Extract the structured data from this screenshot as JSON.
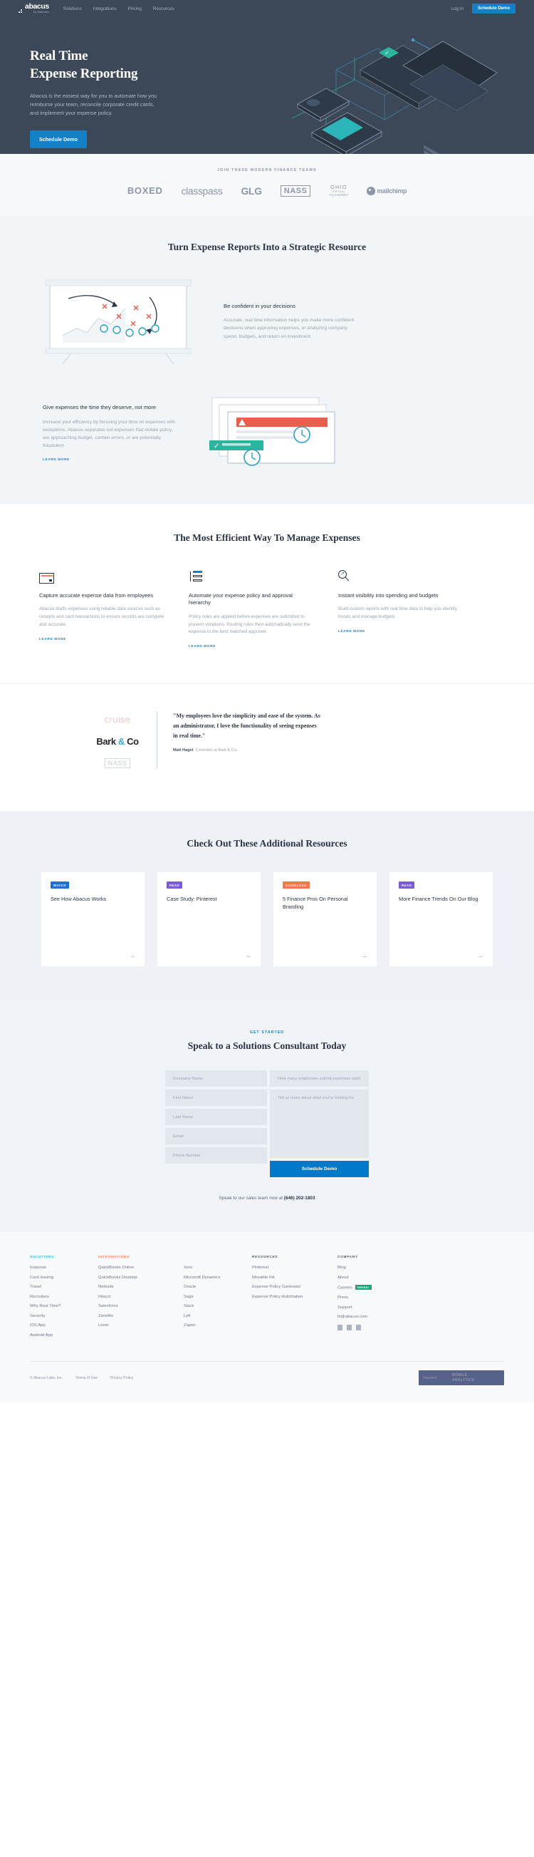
{
  "header": {
    "logo_text": "abacus",
    "logo_sub": "by emburse",
    "nav": [
      {
        "label": "Solutions"
      },
      {
        "label": "Integrations"
      },
      {
        "label": "Pricing"
      },
      {
        "label": "Resources"
      }
    ],
    "login_label": "Log In",
    "demo_label": "Schedule Demo"
  },
  "hero": {
    "title_line1": "Real Time",
    "title_line2": "Expense Reporting",
    "paragraph": "Abacus is the easiest way for you to automate how you reimburse your team, reconcile corporate credit cards, and implement your expense policy.",
    "cta_label": "Schedule Demo"
  },
  "logostrip": {
    "title": "JOIN THESE MODERN FINANCE TEAMS",
    "logos": [
      {
        "name": "BOXED"
      },
      {
        "name": "classpass"
      },
      {
        "name": "GLG"
      },
      {
        "name": "NASS"
      },
      {
        "name": "OHIO",
        "line2": "VIRTUAL",
        "line3": "ACADEMY"
      },
      {
        "name": "mailchimp"
      }
    ]
  },
  "strategic": {
    "title": "Turn Expense Reports Into a Strategic Resource",
    "features": [
      {
        "heading": "Be confident in your decisions",
        "body": "Accurate, real time information helps you make more confident decisions when approving expenses, or analyzing company spend, budgets, and return on investment."
      },
      {
        "heading": "Give expenses the time they deserve, not more",
        "body": "Increase your efficiency by focusing your time on expenses with exceptions. Abacus separates out expenses that violate policy, are approaching budget, contain errors, or are potentially fraudulent.",
        "link": "LEARN MORE"
      }
    ]
  },
  "efficient": {
    "title": "The Most Efficient Way To Manage Expenses",
    "columns": [
      {
        "icon": "credit-card-icon",
        "heading": "Capture accurate expense data from employees",
        "body": "Abacus drafts expenses using reliable data sources such as receipts and card transactions to ensure records are complete and accurate.",
        "link": "LEARN MORE"
      },
      {
        "icon": "workflow-list-icon",
        "heading": "Automate your expense policy and approval hierarchy",
        "body": "Policy rules are applied before expenses are submitted to prevent violations. Routing rules then automatically send the expense to the best matched approver.",
        "link": "LEARN MORE"
      },
      {
        "icon": "magnifier-trend-icon",
        "heading": "Instant visibility into spending and budgets",
        "body": "Build custom reports with real time data to help you identify trends and manage budgets.",
        "link": "LEARN MORE"
      }
    ]
  },
  "testimonial": {
    "logos": [
      {
        "name": "cruise"
      },
      {
        "name": "Bark & Co"
      },
      {
        "name": "NASS"
      }
    ],
    "quote": "\"My employees love the simplicity and ease of the system. As an administrator, I love the functionality of seeing expenses in real time.\"",
    "author": "Matt Hagel",
    "author_role": ", Controller at Bark & Co."
  },
  "resources": {
    "title": "Check Out These Additional Resources",
    "cards": [
      {
        "badge": "WATCH",
        "badge_color": "#1f6fd4",
        "title": "See How Abacus Works",
        "arrow": "→"
      },
      {
        "badge": "READ",
        "badge_color": "#7b5cd6",
        "title": "Case Study: Pinterest",
        "arrow": "→"
      },
      {
        "badge": "DOWNLOAD",
        "badge_color": "#f2784b",
        "title": "5 Finance Pros On Personal Branding",
        "arrow": "→"
      },
      {
        "badge": "READ",
        "badge_color": "#7b5cd6",
        "title": "More Finance Trends On Our Blog",
        "arrow": "→"
      }
    ]
  },
  "form": {
    "eyebrow": "GET STARTED",
    "title": "Speak to a Solutions Consultant Today",
    "fields": [
      {
        "name": "company-name",
        "placeholder": "Company Name",
        "value": ""
      },
      {
        "name": "first-name",
        "placeholder": "First Name",
        "value": ""
      },
      {
        "name": "last-name",
        "placeholder": "Last Name",
        "value": ""
      },
      {
        "name": "email",
        "placeholder": "Email",
        "value": ""
      },
      {
        "name": "phone-number",
        "placeholder": "Phone Number",
        "value": ""
      }
    ],
    "employees_placeholder": "How many employees submit expenses each month?",
    "employees_value": "",
    "message_placeholder": "Tell us more about what you're looking for",
    "message_value": "",
    "submit_label": "Schedule Demo",
    "sales_prefix": "Speak to our sales team now at ",
    "sales_phone": "(646) 202-1803"
  },
  "footer": {
    "columns": [
      {
        "heading": "SOLUTIONS",
        "links": [
          {
            "label": "Expense"
          },
          {
            "label": "Card Issuing"
          },
          {
            "label": "Travel"
          },
          {
            "label": "Recruiters"
          },
          {
            "label": "Why Real Time?"
          },
          {
            "label": "Security"
          },
          {
            "label": "iOS App"
          },
          {
            "label": "Android App"
          }
        ]
      },
      {
        "heading": "INTEGRATIONS",
        "links": [
          {
            "label": "QuickBooks Online"
          },
          {
            "label": "QuickBooks Desktop"
          },
          {
            "label": "Netsuite"
          },
          {
            "label": "Intacct"
          },
          {
            "label": "Salesforce"
          },
          {
            "label": "Zenefits"
          },
          {
            "label": "Lever"
          }
        ]
      },
      {
        "heading": "",
        "links": [
          {
            "label": "Xero"
          },
          {
            "label": "Microsoft Dynamics"
          },
          {
            "label": "Oracle"
          },
          {
            "label": "Sage"
          },
          {
            "label": "Slack"
          },
          {
            "label": "Lyft"
          },
          {
            "label": "Zapier"
          }
        ]
      },
      {
        "heading": "RESOURCES",
        "links": [
          {
            "label": "Pinterest"
          },
          {
            "label": "Movable Ink"
          },
          {
            "label": "Expense Policy Generator"
          },
          {
            "label": "Expense Policy Automation"
          }
        ]
      },
      {
        "heading": "COMPANY",
        "links": [
          {
            "label": "Blog"
          },
          {
            "label": "About"
          },
          {
            "label": "Careers",
            "badge": "HIRING!"
          },
          {
            "label": "Press"
          },
          {
            "label": "Support"
          },
          {
            "label": "hi@abacus.com"
          }
        ]
      }
    ],
    "copyright": "© Abacus Labs, Inc.",
    "terms": "Terms of Use",
    "privacy": "Privacy Policy",
    "mixpanel_name": "mixpanel",
    "mixpanel_tag1": "MOBILE",
    "mixpanel_tag2": "ANALYTICS"
  }
}
